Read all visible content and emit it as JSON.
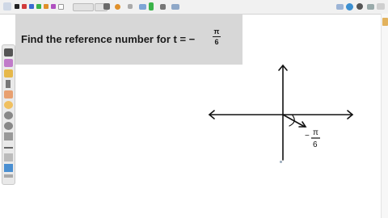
{
  "toolbar": {
    "colors": [
      "#222222",
      "#d13b3b",
      "#3b6bd1",
      "#3bb34a",
      "#e0902a",
      "#b050c0",
      "#ffffff"
    ],
    "icons": [
      "undo-icon",
      "redo-icon",
      "stroke-thin-icon",
      "stroke-medium-icon",
      "stroke-thick-icon",
      "image-icon",
      "lasso-icon",
      "highlighter-icon",
      "eraser-icon",
      "shapes-icon",
      "text-icon",
      "more-icon"
    ],
    "right_icons": [
      "photo-icon",
      "globe-icon",
      "settings-icon",
      "camera-icon"
    ]
  },
  "left_tools": [
    "pen-icon",
    "pen-color-icon",
    "highlighter-icon",
    "select-icon",
    "eraser-icon",
    "lasso-icon",
    "zoom-in-icon",
    "zoom-out-icon",
    "pointer-icon",
    "line-icon",
    "text-icon",
    "image-icon",
    "ruler-icon"
  ],
  "question": {
    "text": "Find the reference number for t = −",
    "numerator": "π",
    "denominator": "6"
  },
  "annotation": {
    "numerator": "π",
    "denominator": "6",
    "sign": "−"
  }
}
